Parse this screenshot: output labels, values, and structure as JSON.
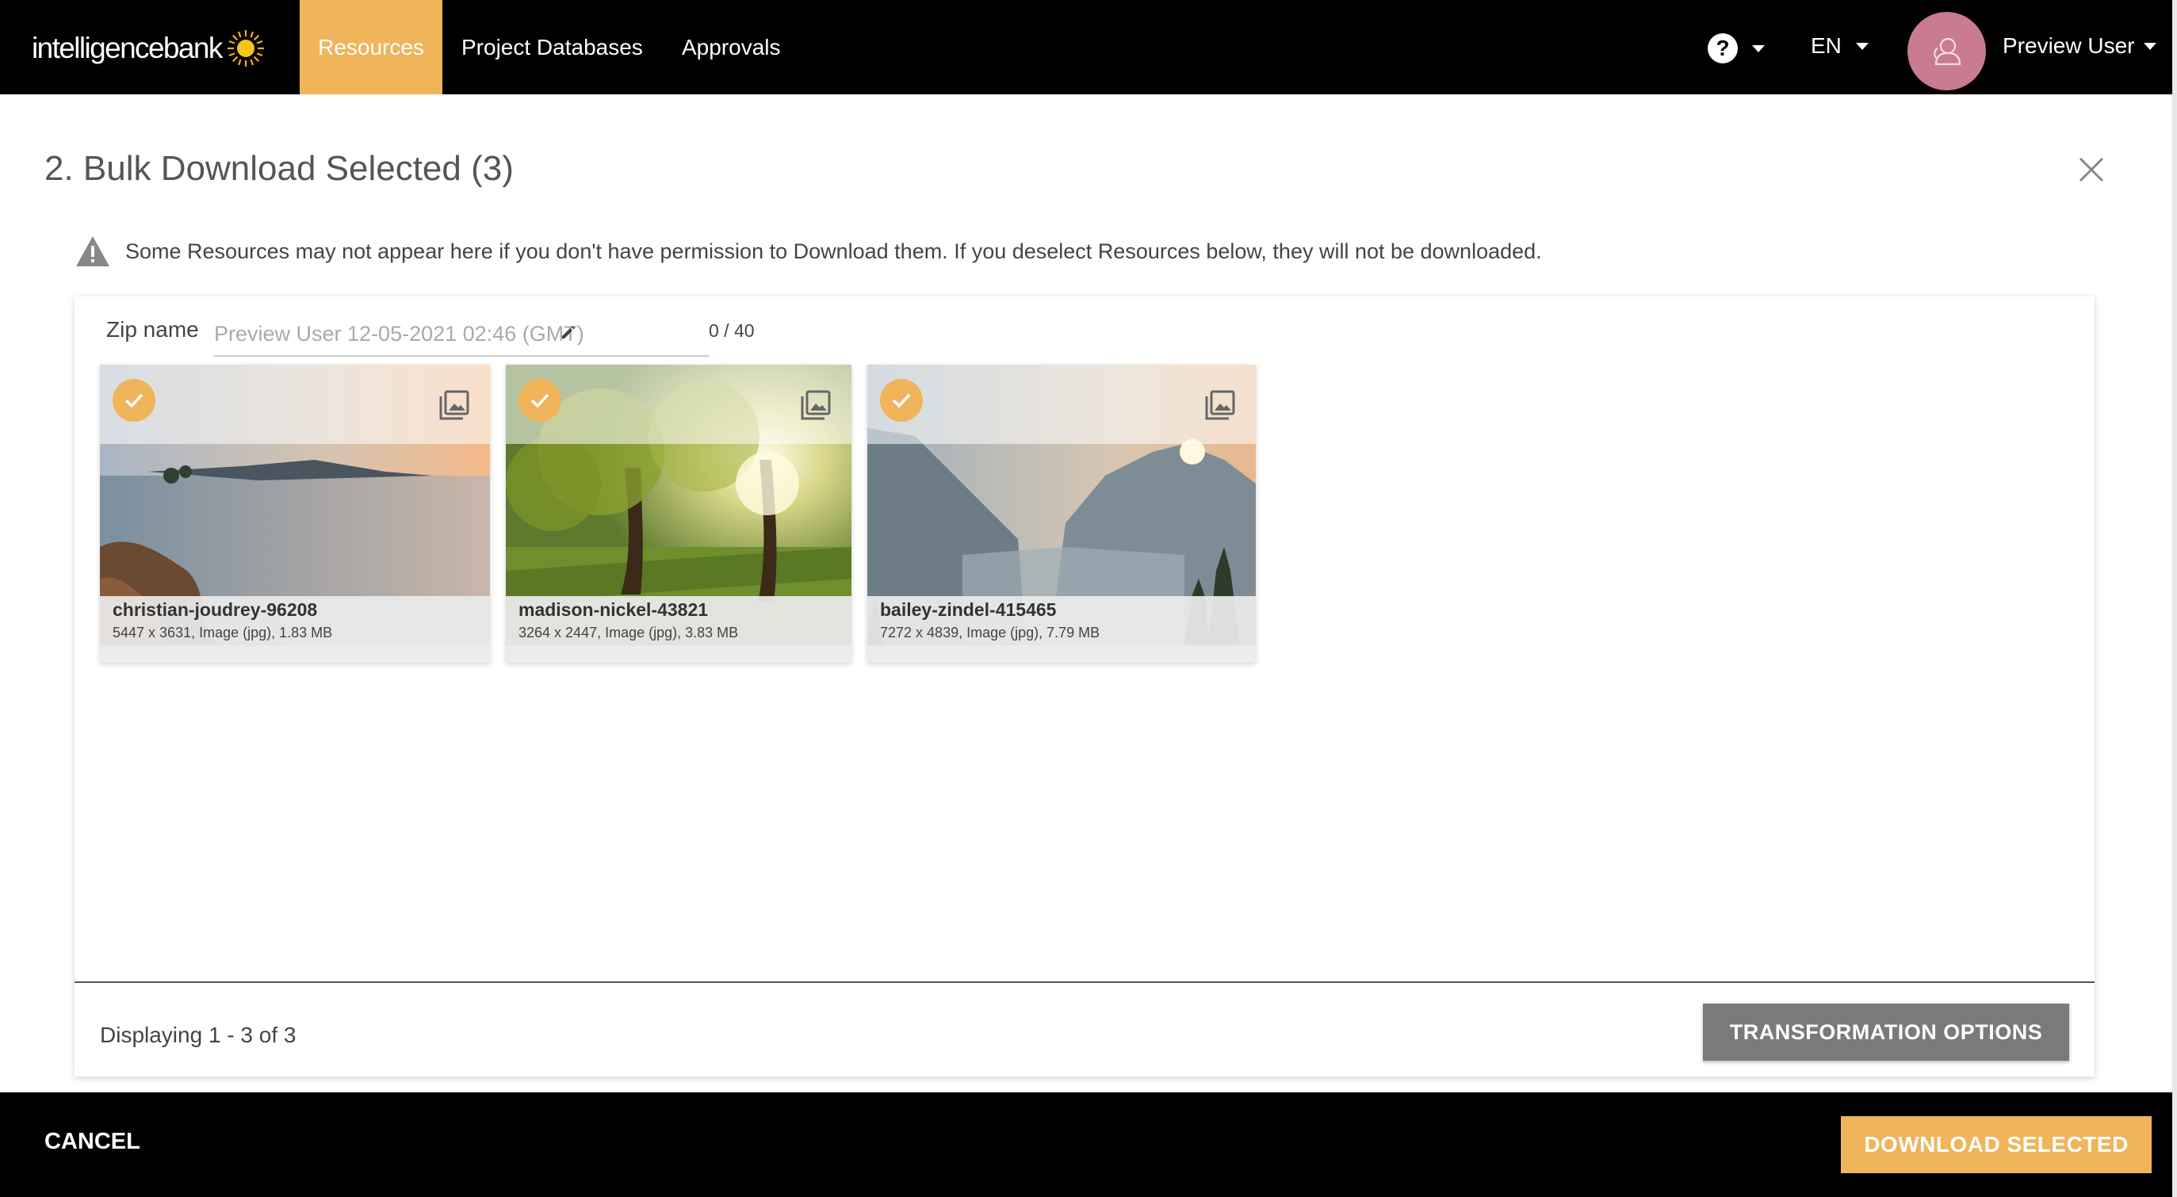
{
  "nav": {
    "logo_text": "intelligencebank",
    "items": [
      {
        "label": "Resources",
        "active": true
      },
      {
        "label": "Project Databases",
        "active": false
      },
      {
        "label": "Approvals",
        "active": false
      }
    ],
    "help_label": "?",
    "language": "EN",
    "user_name": "Preview User",
    "accent_color": "#f0b45a"
  },
  "modal": {
    "title": "2. Bulk Download Selected (3)",
    "notice": "Some Resources may not appear here if you don't have permission to Download them. If you deselect Resources below, they will not be downloaded.",
    "zip_label": "Zip name",
    "zip_placeholder": "Preview User 12-05-2021 02:46 (GMT)",
    "zip_value": "",
    "zip_count": "0 / 40"
  },
  "cards": [
    {
      "name": "christian-joudrey-96208",
      "info": "5447 x 3631, Image (jpg), 1.83 MB",
      "selected": true,
      "icon": "image-icon"
    },
    {
      "name": "madison-nickel-43821",
      "info": "3264 x 2447, Image (jpg), 3.83 MB",
      "selected": true,
      "icon": "image-icon"
    },
    {
      "name": "bailey-zindel-415465",
      "info": "7272 x 4839, Image (jpg), 7.79 MB",
      "selected": true,
      "icon": "image-icon"
    }
  ],
  "footer": {
    "displaying": "Displaying 1 - 3 of 3",
    "transform_label": "TRANSFORMATION OPTIONS"
  },
  "actions": {
    "cancel_label": "CANCEL",
    "download_label": "DOWNLOAD SELECTED"
  }
}
